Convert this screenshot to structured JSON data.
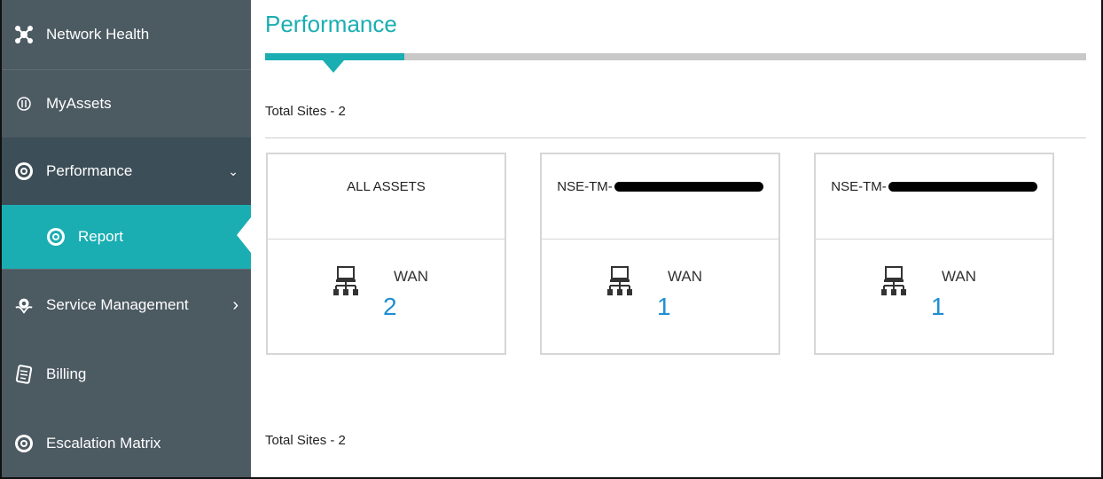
{
  "sidebar": {
    "items": [
      {
        "label": "Network Health",
        "icon": "network-health-icon"
      },
      {
        "label": "MyAssets",
        "icon": "assets-icon"
      },
      {
        "label": "Performance",
        "icon": "performance-icon",
        "chevron": "⌄"
      },
      {
        "label": "Report",
        "icon": "report-icon"
      },
      {
        "label": "Service Management",
        "icon": "service-management-icon",
        "chevron": "›"
      },
      {
        "label": "Billing",
        "icon": "billing-icon"
      },
      {
        "label": "Escalation Matrix",
        "icon": "escalation-icon"
      }
    ]
  },
  "main": {
    "title": "Performance",
    "total_sites_top": "Total Sites - 2",
    "total_sites_bottom": "Total Sites - 2",
    "cards": [
      {
        "title": "ALL ASSETS",
        "label": "WAN",
        "count": "2"
      },
      {
        "title": "NSE-TM-",
        "label": "WAN",
        "count": "1"
      },
      {
        "title": "NSE-TM-",
        "label": "WAN",
        "count": "1"
      }
    ]
  },
  "colors": {
    "sidebar_bg": "#4c5a62",
    "accent": "#1aaeb2",
    "count_blue": "#1f8fd0"
  }
}
